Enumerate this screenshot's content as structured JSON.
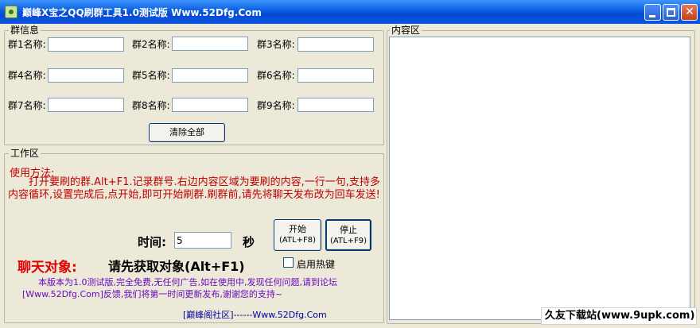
{
  "window": {
    "title": "巅峰Χ宝之QQ刷群工具1.0测试版 Www.52Dfg.Com"
  },
  "group_info": {
    "section_label": "群信息",
    "fields": [
      {
        "label": "群1名称:",
        "value": ""
      },
      {
        "label": "群2名称:",
        "value": ""
      },
      {
        "label": "群3名称:",
        "value": ""
      },
      {
        "label": "群4名称:",
        "value": ""
      },
      {
        "label": "群5名称:",
        "value": ""
      },
      {
        "label": "群6名称:",
        "value": ""
      },
      {
        "label": "群7名称:",
        "value": ""
      },
      {
        "label": "群8名称:",
        "value": ""
      },
      {
        "label": "群9名称:",
        "value": ""
      }
    ],
    "clear_button": "清除全部"
  },
  "work_area": {
    "section_label": "工作区",
    "usage_title": "使用方法:",
    "usage_text": "打开要刷的群.Alt+F1.记录群号.右边内容区域为要刷的内容,一行一句,支持多内容循环,设置完成后,点开始,即可开始刷群.刷群前,请先将聊天发布改为回车发送!",
    "time_label": "时间:",
    "time_value": "5",
    "seconds_label": "秒",
    "start_button": {
      "line1": "开始",
      "line2": "(ATL+F8)"
    },
    "stop_button": {
      "line1": "停止",
      "line2": "(ATL+F9)"
    },
    "chat_target_label": "聊天对象:",
    "chat_target_value": "请先获取对象(Alt+F1)",
    "hotkey_checkbox_label": "启用热键",
    "hotkey_checked": false,
    "notice": "本版本为1.0测试版,完全免费,无任何广告,如在使用中,发现任何问题,请到论坛[Www.52Dfg.Com]反馈,我们将第一时间更新发布,谢谢您的支持~",
    "footer_link": "[巅峰阁社区]------Www.52Dfg.Com"
  },
  "content_area": {
    "section_label": "内容区",
    "value": ""
  },
  "watermark": "久友下载站(www.9upk.com)",
  "icons": [
    "app-icon",
    "minimize-icon",
    "maximize-icon",
    "close-icon"
  ],
  "colors": {
    "title_bar": "#0a5ee0",
    "usage_text": "#c00000",
    "chat_label": "#e00000",
    "notice": "#6a0ac0",
    "footer_link": "#0000a0"
  }
}
